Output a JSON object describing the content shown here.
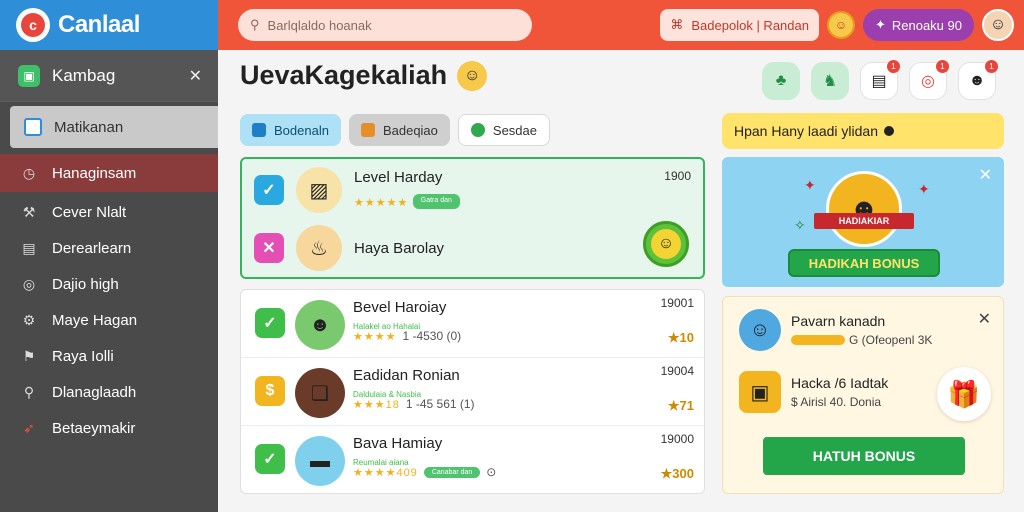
{
  "brand": {
    "name": "Canlaal",
    "tagline": ""
  },
  "search": {
    "placeholder": "Barlqlaldo hoanak"
  },
  "topbar": {
    "pill_label": "Badepolok | Randan",
    "points_label": "Renoaku 90"
  },
  "sidebar": {
    "header_label": "Kambag",
    "selected_label": "Matikanan",
    "items": [
      {
        "label": "Hanaginsam",
        "icon": "clock-icon",
        "active": true
      },
      {
        "label": "Cever Nlalt",
        "icon": "tool-icon"
      },
      {
        "label": "Derearlearn",
        "icon": "card-icon"
      },
      {
        "label": "Dajio high",
        "icon": "circle-icon"
      },
      {
        "label": "Maye Hagan",
        "icon": "gear-icon"
      },
      {
        "label": "Raya Iolli",
        "icon": "flag-icon"
      },
      {
        "label": "Dlanaglaadh",
        "icon": "search-icon"
      },
      {
        "label": "Betaeymakir",
        "icon": "rocket-icon"
      }
    ]
  },
  "main": {
    "title": "UevaKagekaliah",
    "tabs": [
      {
        "label": "Bodenaln"
      },
      {
        "label": "Badeqiao"
      },
      {
        "label": "Sesdae"
      }
    ],
    "featured": [
      {
        "title": "Level Harday",
        "stars": "★★★★★",
        "badge": "Gatra dan",
        "number": "1900"
      },
      {
        "title": "Haya Barolay"
      }
    ],
    "games": [
      {
        "title": "Bevel Haroiay",
        "subtitle": "Halakel ao Hahalai",
        "stars": "★★★★",
        "meta": "1 -4530 (0)",
        "number": "19001",
        "score": "★10"
      },
      {
        "title": "Eadidan Ronian",
        "subtitle": "Daldulaia & Nasbia",
        "stars": "★★★18",
        "meta": "1 -45 561 (1)",
        "number": "19004",
        "score": "★71"
      },
      {
        "title": "Bava Hamiay",
        "subtitle": "Reumalai aiana",
        "stars": "★★★★409",
        "badge": "Canabar dan",
        "number": "19000",
        "score": "★300"
      }
    ]
  },
  "right": {
    "header": "Hpan Hany laadi ylidan",
    "promo_label": "HADIAKIAR",
    "promo_button": "HADIKAH BONUS",
    "bonus": [
      {
        "title": "Pavarn kanadn",
        "subtitle": "G (Ofeopenl 3K"
      },
      {
        "title": "Hacka /6 Iadtak",
        "subtitle": "$ Airisl 40. Donia"
      }
    ],
    "bonus_button": "HATUH BONUS"
  }
}
